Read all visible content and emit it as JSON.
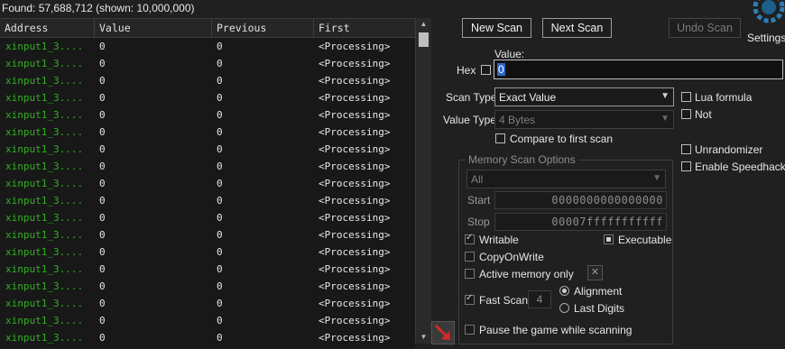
{
  "status": {
    "found_text": "Found: 57,688,712 (shown: 10,000,000)"
  },
  "table": {
    "columns": [
      "Address",
      "Value",
      "Previous",
      "First"
    ],
    "rows": [
      {
        "address": "xinput1_3....",
        "value": "0",
        "previous": "0",
        "first": "<Processing>"
      },
      {
        "address": "xinput1_3....",
        "value": "0",
        "previous": "0",
        "first": "<Processing>"
      },
      {
        "address": "xinput1_3....",
        "value": "0",
        "previous": "0",
        "first": "<Processing>"
      },
      {
        "address": "xinput1_3....",
        "value": "0",
        "previous": "0",
        "first": "<Processing>"
      },
      {
        "address": "xinput1_3....",
        "value": "0",
        "previous": "0",
        "first": "<Processing>"
      },
      {
        "address": "xinput1_3....",
        "value": "0",
        "previous": "0",
        "first": "<Processing>"
      },
      {
        "address": "xinput1_3....",
        "value": "0",
        "previous": "0",
        "first": "<Processing>"
      },
      {
        "address": "xinput1_3....",
        "value": "0",
        "previous": "0",
        "first": "<Processing>"
      },
      {
        "address": "xinput1_3....",
        "value": "0",
        "previous": "0",
        "first": "<Processing>"
      },
      {
        "address": "xinput1_3....",
        "value": "0",
        "previous": "0",
        "first": "<Processing>"
      },
      {
        "address": "xinput1_3....",
        "value": "0",
        "previous": "0",
        "first": "<Processing>"
      },
      {
        "address": "xinput1_3....",
        "value": "0",
        "previous": "0",
        "first": "<Processing>"
      },
      {
        "address": "xinput1_3....",
        "value": "0",
        "previous": "0",
        "first": "<Processing>"
      },
      {
        "address": "xinput1_3....",
        "value": "0",
        "previous": "0",
        "first": "<Processing>"
      },
      {
        "address": "xinput1_3....",
        "value": "0",
        "previous": "0",
        "first": "<Processing>"
      },
      {
        "address": "xinput1_3....",
        "value": "0",
        "previous": "0",
        "first": "<Processing>"
      },
      {
        "address": "xinput1_3....",
        "value": "0",
        "previous": "0",
        "first": "<Processing>"
      },
      {
        "address": "xinput1_3....",
        "value": "0",
        "previous": "0",
        "first": "<Processing>"
      },
      {
        "address": "xinput1_3....",
        "value": "0",
        "previous": "0",
        "first": "<Processing>"
      }
    ]
  },
  "toolbar": {
    "new_scan": "New Scan",
    "next_scan": "Next Scan",
    "undo_scan": "Undo Scan",
    "settings": "Settings"
  },
  "value": {
    "label": "Value:",
    "hex_label": "Hex",
    "input_value": "0"
  },
  "scan_type": {
    "label": "Scan Type",
    "selected": "Exact Value"
  },
  "value_type": {
    "label": "Value Type",
    "selected": "4 Bytes"
  },
  "options": {
    "compare_first": "Compare to first scan",
    "lua_formula": "Lua formula",
    "not": "Not",
    "unrandomizer": "Unrandomizer",
    "enable_speedhack": "Enable Speedhack"
  },
  "memory": {
    "title": "Memory Scan Options",
    "region": "All",
    "start_label": "Start",
    "start_value": "0000000000000000",
    "stop_label": "Stop",
    "stop_value": "00007fffffffffff",
    "writable": "Writable",
    "executable": "Executable",
    "copy_on_write": "CopyOnWrite",
    "active_memory_only": "Active memory only",
    "fast_scan": "Fast Scan",
    "fast_scan_value": "4",
    "alignment": "Alignment",
    "last_digits": "Last Digits",
    "pause_game": "Pause the game while scanning"
  },
  "colors": {
    "address_green": "#33b024",
    "selection_blue": "#2f66c9",
    "arrow_red": "#d42a2a"
  }
}
